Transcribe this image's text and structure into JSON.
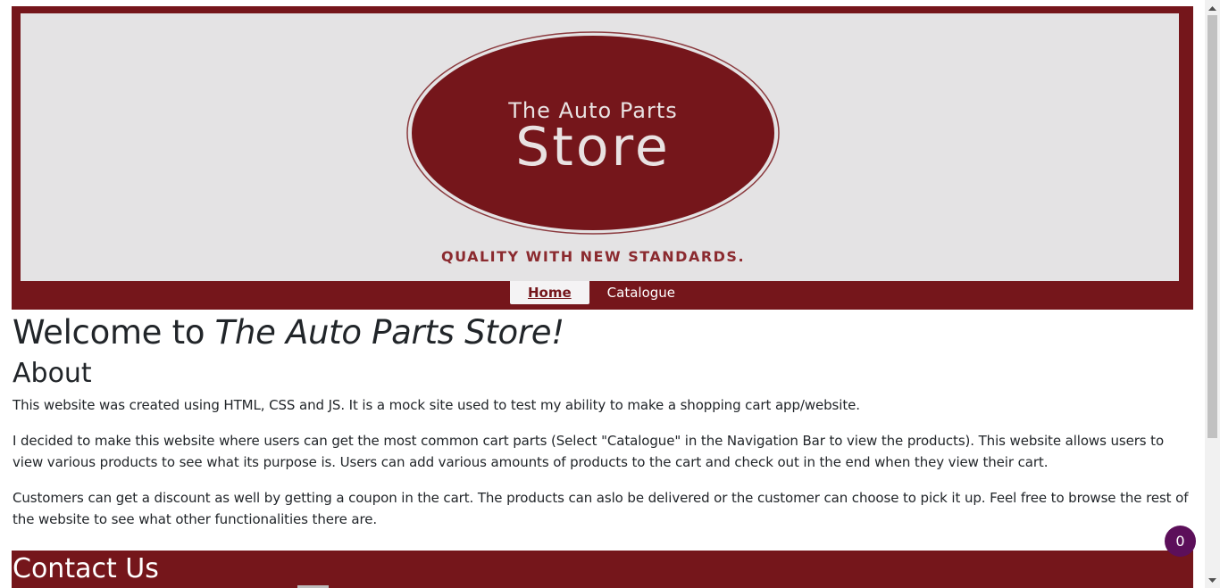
{
  "header": {
    "logo": {
      "line1": "The Auto Parts",
      "line2": "Store",
      "tagline": "QUALITY WITH NEW STANDARDS."
    },
    "nav": [
      {
        "label": "Home",
        "active": true
      },
      {
        "label": "Catalogue",
        "active": false
      }
    ]
  },
  "main": {
    "welcome_prefix": "Welcome to ",
    "welcome_store": "The Auto Parts Store!",
    "about_heading": "About",
    "paragraphs": [
      "This website was created using HTML, CSS and JS. It is a mock site used to test my ability to make a shopping cart app/website.",
      "I decided to make this website where users can get the most common cart parts (Select \"Catalogue\" in the Navigation Bar to view the products). This website allows users to view various products to see what its purpose is. Users can add various amounts of products to the cart and check out in the end when they view their cart.",
      "Customers can get a discount as well by getting a coupon in the cart. The products can aslo be delivered or the customer can choose to pick it up. Feel free to browse the rest of the website to see what other functionalities there are."
    ]
  },
  "contact": {
    "heading": "Contact Us"
  },
  "cart": {
    "count": "0"
  },
  "colors": {
    "brand": "#75161b",
    "banner_bg": "#e4e3e4",
    "cart_badge": "#5c0f5a"
  }
}
